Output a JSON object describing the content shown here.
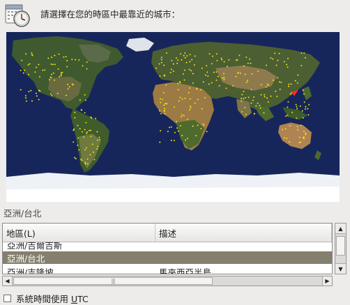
{
  "header": {
    "icon": "clock-calendar-icon",
    "prompt": "請選擇在您的時區中最靠近的城市："
  },
  "map": {
    "ocean_color": "#17265a",
    "selected_marker_color": "#ff2a2a",
    "city_dot_color": "#f4e21a"
  },
  "selected_zone": "亞洲/台北",
  "table": {
    "columns": {
      "region": "地區(L)",
      "description": "描述"
    },
    "rows": [
      {
        "region": "亞洲/吉爾吉斯",
        "description": "",
        "partial": true
      },
      {
        "region": "亞洲/台北",
        "description": "",
        "selected": true
      },
      {
        "region": "亞洲/吉隆坡",
        "description": "馬來西亞半島",
        "partial": true
      }
    ]
  },
  "utc": {
    "label_prefix": "系統時間使用 ",
    "label_mnemonic": "U",
    "label_rest": "TC",
    "checked": false
  }
}
